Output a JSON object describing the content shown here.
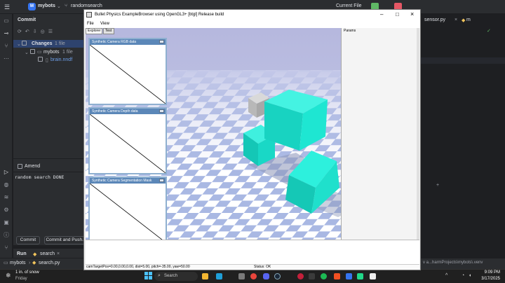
{
  "ide": {
    "project_initial": "M",
    "project_name": "mybots",
    "branch": "randomsearch",
    "run_config": "Current File",
    "editor_tab": "sensor.py",
    "editor_tab2": "m"
  },
  "commit": {
    "title": "Commit",
    "changes_label": "Changes",
    "changes_count": "1 file",
    "folder": "mybots",
    "folder_count": "1 file",
    "file": "brain.nndf",
    "amend_label": "Amend",
    "message": "random search DONE",
    "commit_button": "Commit",
    "commit_push_button": "Commit and Push..."
  },
  "run": {
    "title": "Run",
    "config": "search"
  },
  "status": {
    "breadcrumb_root": "mybots",
    "breadcrumb_file": "search.py",
    "venv": "v a...harmProjects\\mybots\\.venv"
  },
  "bullet": {
    "title": "Bullet Physics ExampleBrowser using OpenGL3+ [btgl] Release build",
    "menu": [
      "File",
      "View"
    ],
    "tabs": [
      "Explorer",
      "Test"
    ],
    "params_label": "Params",
    "panels": [
      "Synthetic Camera RGB data",
      "Synthetic Camera Depth data",
      "Synthetic Camera Segmentation Mask"
    ],
    "status_camera": "camTargetPos=0.00,0.00,0.00, dist=5.00, pitch=-35.00, yaw=50.00",
    "status_text": "Status: OK"
  },
  "taskbar": {
    "weather_temp": "1 in. of snow",
    "weather_day": "Friday",
    "search_placeholder": "Search",
    "time": "9:09 PM",
    "date": "3/17/2025"
  },
  "colors": {
    "accent": "#3574f0",
    "cube": "#1ee6d2",
    "floor_blue": "#aab9e4",
    "floor_white": "#ffffff",
    "sky": "#b8bde3"
  }
}
